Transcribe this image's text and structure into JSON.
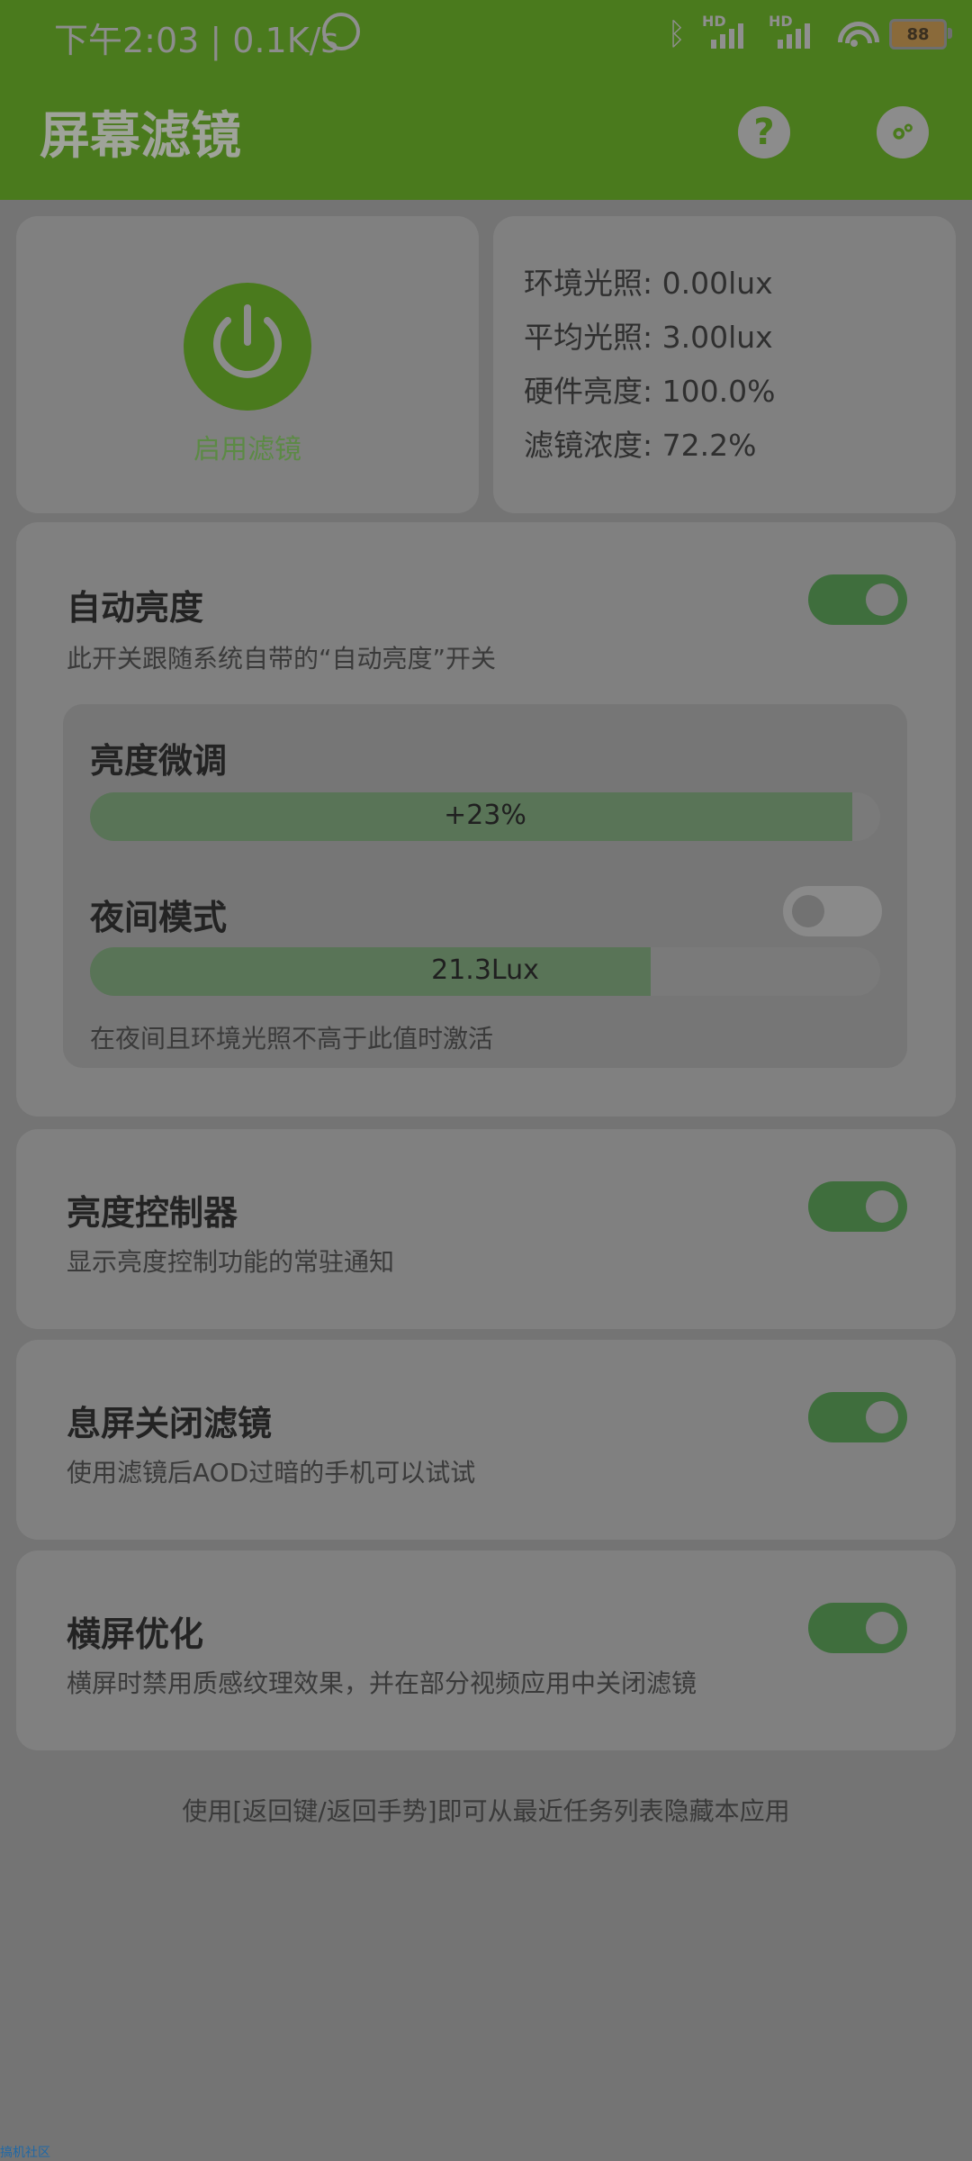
{
  "status_bar": {
    "time_speed": "下午2:03 | 0.1K/s",
    "signal_1": "HD",
    "signal_2": "HD",
    "battery": "88"
  },
  "app_bar": {
    "title": "屏幕滤镜",
    "help": "?"
  },
  "filter_card": {
    "label": "启用滤镜"
  },
  "info": {
    "ambient": "环境光照: 0.00lux",
    "average": "平均光照: 3.00lux",
    "hardware": "硬件亮度: 100.0%",
    "filter": "滤镜浓度: 72.2%"
  },
  "auto_brightness": {
    "title": "自动亮度",
    "desc": "此开关跟随系统自带的“自动亮度”开关",
    "brightness_tune": {
      "title": "亮度微调",
      "value": "+23%",
      "fill_fraction": 0.965
    },
    "night_mode": {
      "title": "夜间模式",
      "value": "21.3Lux",
      "fill_fraction": 0.71,
      "desc": "在夜间且环境光照不高于此值时激活"
    }
  },
  "brightness_controller": {
    "title": "亮度控制器",
    "desc": "显示亮度控制功能的常驻通知"
  },
  "screen_off": {
    "title": "息屏关闭滤镜",
    "desc": "使用滤镜后AOD过暗的手机可以试试"
  },
  "landscape": {
    "title": "横屏优化",
    "desc": "横屏时禁用质感纹理效果，并在部分视频应用中关闭滤镜"
  },
  "footer": {
    "hint": "使用[返回键/返回手势]即可从最近任务列表隐藏本应用"
  },
  "watermark": "搞机社区"
}
